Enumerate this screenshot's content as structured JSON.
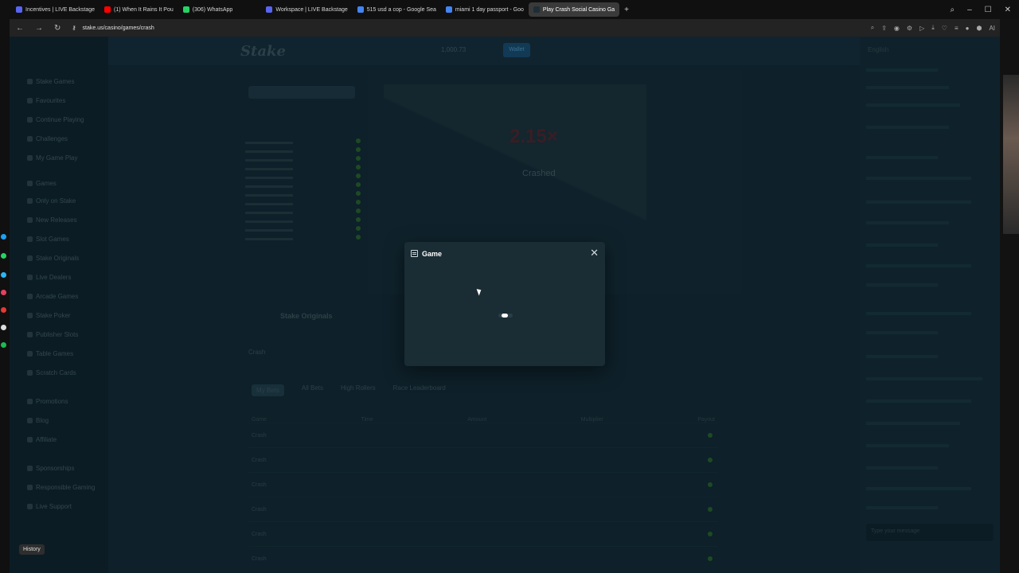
{
  "browser": {
    "tabs": [
      {
        "label": "Incentives | LIVE Backstage",
        "color": "#5865f2"
      },
      {
        "label": "(1) When It Rains It Pou",
        "color": "#ff0000"
      },
      {
        "label": "(306) WhatsApp",
        "color": "#25d366"
      },
      {
        "label": "Workspace | LIVE Backstage",
        "color": "#5865f2"
      },
      {
        "label": "515 usd a cop - Google Sea",
        "color": "#4285f4"
      },
      {
        "label": "miami 1 day passport - Goo",
        "color": "#4285f4"
      },
      {
        "label": "Play Crash Social Casino Ga",
        "color": "#1e2e36"
      }
    ],
    "url": "stake.us/casino/games/crash",
    "history_tooltip": "History",
    "ai_label": "AI"
  },
  "site": {
    "logo": "Stake",
    "balance": "1,000.73",
    "wallet_label": "Wallet",
    "sidebar_items": [
      "Stake Games",
      "Favourites",
      "Continue Playing",
      "Challenges",
      "My Game Play",
      "Games",
      "Only on Stake",
      "New Releases",
      "Slot Games",
      "Stake Originals",
      "Live Dealers",
      "Arcade Games",
      "Stake Poker",
      "Publisher Slots",
      "Table Games",
      "Scratch Cards",
      "Promotions",
      "Blog",
      "Affiliate",
      "Sponsorships",
      "Responsible Gaming",
      "Live Support"
    ],
    "game": {
      "multiplier": "2.15×",
      "status": "Crashed",
      "origin_title": "Stake Originals",
      "crash_tab": "Crash"
    },
    "bet_tabs": [
      "My Bets",
      "All Bets",
      "High Rollers",
      "Race Leaderboard"
    ],
    "table_headers": [
      "Game",
      "Time",
      "Amount",
      "Multiplier",
      "Payout"
    ],
    "table_rows": [
      "Crash",
      "Crash",
      "Crash",
      "Crash",
      "Crash",
      "Crash"
    ],
    "language": "English",
    "chat_input_placeholder": "Type your message"
  },
  "modal": {
    "title": "Game",
    "close_icon": "close-icon"
  }
}
